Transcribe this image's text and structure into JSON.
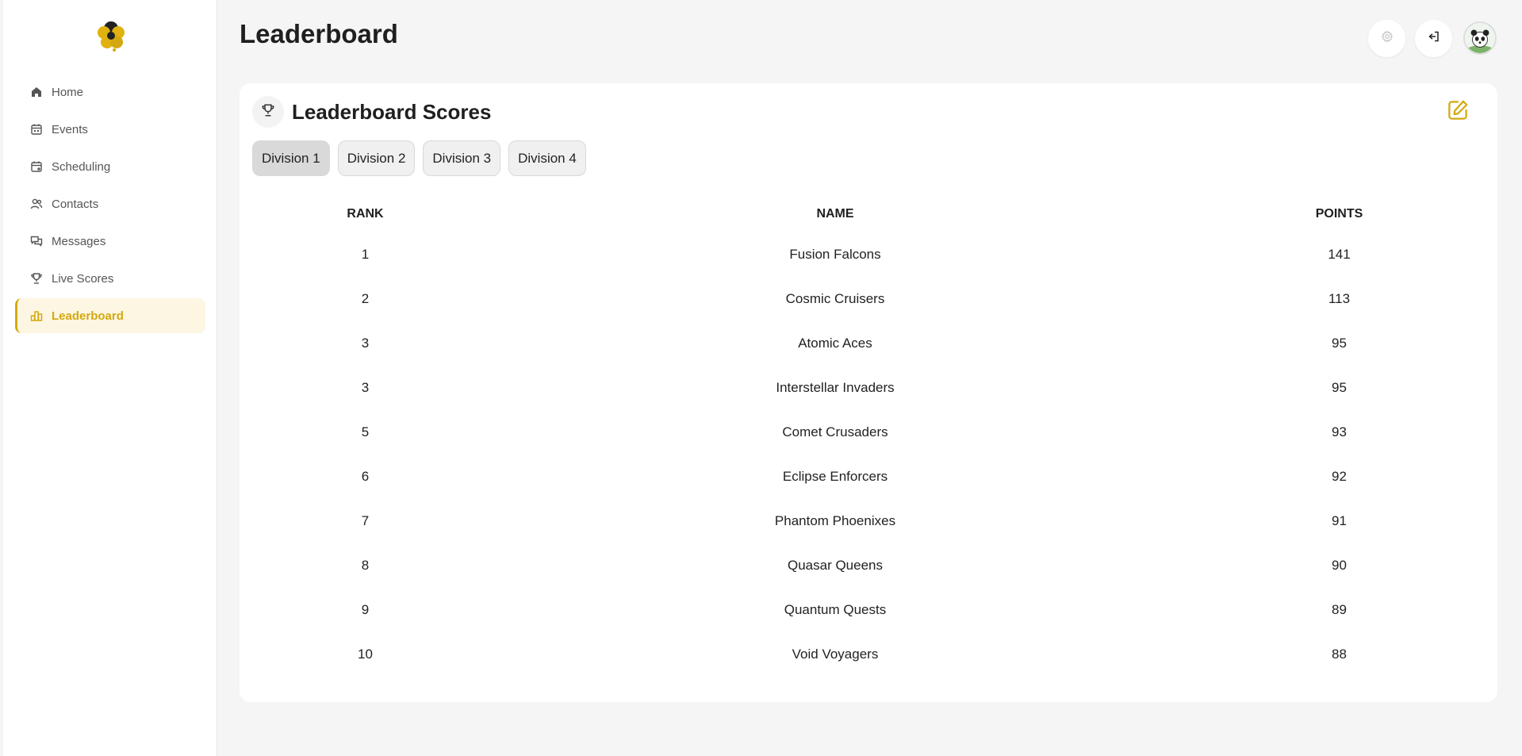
{
  "sidebar": {
    "items": [
      {
        "label": "Home",
        "icon": "home-icon"
      },
      {
        "label": "Events",
        "icon": "calendar-icon"
      },
      {
        "label": "Scheduling",
        "icon": "calendar-plus-icon"
      },
      {
        "label": "Contacts",
        "icon": "users-icon"
      },
      {
        "label": "Messages",
        "icon": "messages-icon"
      },
      {
        "label": "Live Scores",
        "icon": "trophy-icon"
      },
      {
        "label": "Leaderboard",
        "icon": "bar-chart-icon",
        "active": true
      }
    ]
  },
  "header": {
    "title": "Leaderboard"
  },
  "card": {
    "title": "Leaderboard Scores",
    "tabs": [
      {
        "label": "Division 1",
        "active": true
      },
      {
        "label": "Division 2"
      },
      {
        "label": "Division 3"
      },
      {
        "label": "Division 4"
      }
    ],
    "columns": [
      "RANK",
      "NAME",
      "POINTS"
    ],
    "rows": [
      {
        "rank": "1",
        "name": "Fusion Falcons",
        "points": "141"
      },
      {
        "rank": "2",
        "name": "Cosmic Cruisers",
        "points": "113"
      },
      {
        "rank": "3",
        "name": "Atomic Aces",
        "points": "95"
      },
      {
        "rank": "3",
        "name": "Interstellar Invaders",
        "points": "95"
      },
      {
        "rank": "5",
        "name": "Comet Crusaders",
        "points": "93"
      },
      {
        "rank": "6",
        "name": "Eclipse Enforcers",
        "points": "92"
      },
      {
        "rank": "7",
        "name": "Phantom Phoenixes",
        "points": "91"
      },
      {
        "rank": "8",
        "name": "Quasar Queens",
        "points": "90"
      },
      {
        "rank": "9",
        "name": "Quantum Quests",
        "points": "89"
      },
      {
        "rank": "10",
        "name": "Void Voyagers",
        "points": "88"
      }
    ]
  },
  "colors": {
    "accent": "#d4a90f",
    "active_bg": "#fdf6e3"
  }
}
